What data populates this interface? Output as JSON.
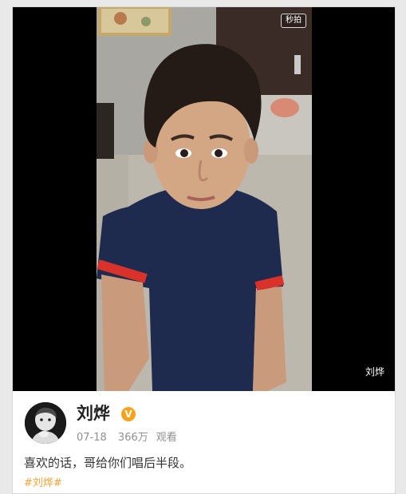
{
  "video": {
    "badge_text": "秒拍",
    "watermark_name": "刘烨"
  },
  "post": {
    "username": "刘烨",
    "verified_badge": "V",
    "date": "07-18",
    "views": "366万",
    "views_suffix": "观看",
    "caption": "喜欢的话，哥给你们唱后半段。",
    "hashtag": "#刘烨#"
  },
  "colors": {
    "hashtag": "#f4a43a",
    "verified": "#f7a21b",
    "shirt": "#1f2a4f",
    "shirt_trim": "#d9322b"
  }
}
